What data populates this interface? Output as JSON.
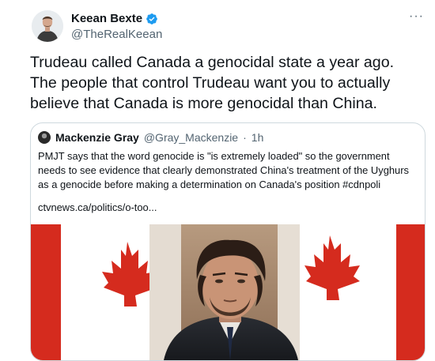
{
  "tweet": {
    "author_name": "Keean Bexte",
    "author_handle": "@TheRealKeean",
    "text_lines": [
      "Trudeau called Canada a genocidal state a year ago.",
      "The people that control Trudeau want you to actually",
      "believe that Canada is more genocidal than China."
    ]
  },
  "quote": {
    "author_name": "Mackenzie Gray",
    "author_handle": "@Gray_Mackenzie",
    "separator": "·",
    "time": "1h",
    "text_lines": [
      "PMJT says that the word genocide is \"is extremely loaded\" so the government",
      "needs to see evidence that clearly demonstrated China's treatment of the Uyghurs",
      "as a genocide before making a determination on Canada's position #cdnpoli"
    ],
    "link": "ctvnews.ca/politics/o-too..."
  },
  "icons": {
    "verified": "verified-badge-icon",
    "more": "more-options-icon"
  },
  "colors": {
    "verified_blue": "#1d9bf0",
    "secondary_text": "#536471",
    "border": "#cfd9de"
  }
}
